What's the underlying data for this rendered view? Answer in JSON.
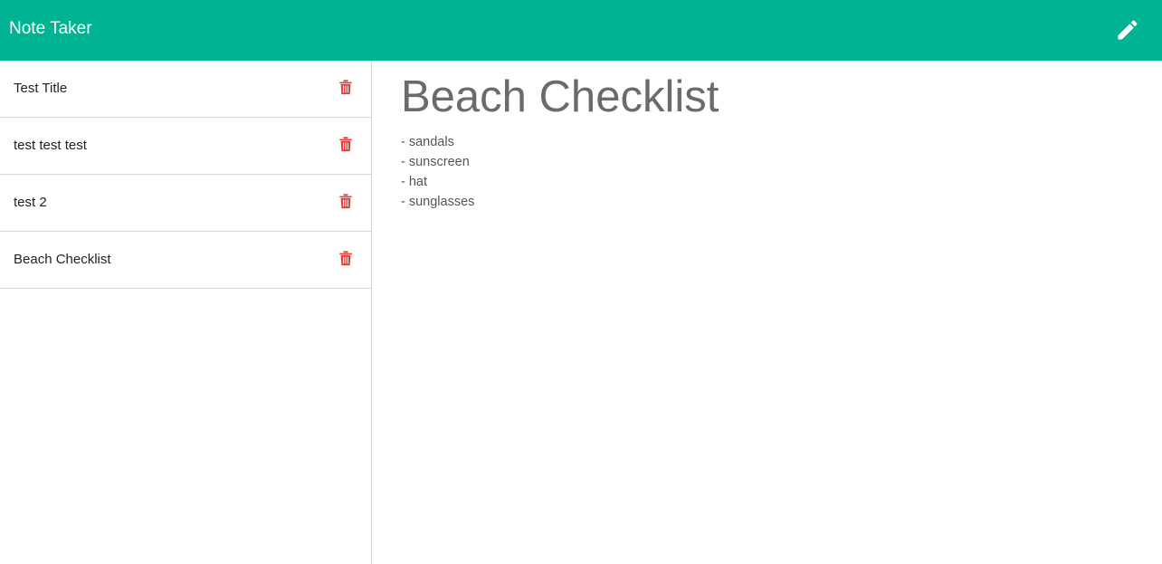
{
  "app": {
    "title": "Note Taker",
    "accent_color": "#00b393",
    "delete_color": "#e53935"
  },
  "navbar": {
    "new_note_icon": "pencil-icon"
  },
  "sidebar": {
    "notes": [
      {
        "title": "Test Title",
        "delete_icon": "trash-icon"
      },
      {
        "title": "test test test",
        "delete_icon": "trash-icon"
      },
      {
        "title": "test 2",
        "delete_icon": "trash-icon"
      },
      {
        "title": "Beach Checklist",
        "delete_icon": "trash-icon"
      }
    ]
  },
  "active_note": {
    "title": "Beach Checklist",
    "lines": [
      "- sandals",
      "- sunscreen",
      "- hat",
      "- sunglasses"
    ]
  }
}
